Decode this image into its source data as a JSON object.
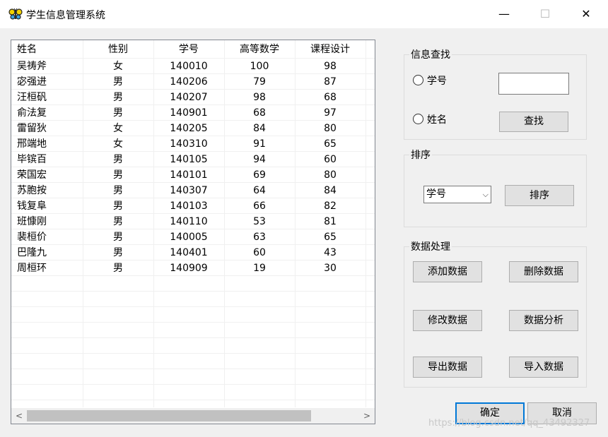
{
  "window": {
    "title": "学生信息管理系统",
    "minimize": "—",
    "maximize": "☐",
    "close": "✕"
  },
  "table": {
    "columns": [
      "姓名",
      "性别",
      "学号",
      "高等数学",
      "课程设计"
    ],
    "rows": [
      [
        "吴祷斧",
        "女",
        "140010",
        "100",
        "98"
      ],
      [
        "宓强进",
        "男",
        "140206",
        "79",
        "87"
      ],
      [
        "汪桓矾",
        "男",
        "140207",
        "98",
        "68"
      ],
      [
        "俞法复",
        "男",
        "140901",
        "68",
        "97"
      ],
      [
        "雷留狄",
        "女",
        "140205",
        "84",
        "80"
      ],
      [
        "邢端地",
        "女",
        "140310",
        "91",
        "65"
      ],
      [
        "毕镔百",
        "男",
        "140105",
        "94",
        "60"
      ],
      [
        "荣国宏",
        "男",
        "140101",
        "69",
        "80"
      ],
      [
        "苏胞按",
        "男",
        "140307",
        "64",
        "84"
      ],
      [
        "钱复阜",
        "男",
        "140103",
        "66",
        "82"
      ],
      [
        "班慷刚",
        "男",
        "140110",
        "53",
        "81"
      ],
      [
        "裴桓价",
        "男",
        "140005",
        "63",
        "65"
      ],
      [
        "巴隆九",
        "男",
        "140401",
        "60",
        "43"
      ],
      [
        "周桓环",
        "男",
        "140909",
        "19",
        "30"
      ]
    ],
    "scroll_left": "<",
    "scroll_right": ">"
  },
  "search_group": {
    "title": "信息查找",
    "radio_id_label": "学号",
    "radio_name_label": "姓名",
    "search_input_value": "",
    "search_button": "查找"
  },
  "sort_group": {
    "title": "排序",
    "sort_field_selected": "学号",
    "sort_button": "排序"
  },
  "data_group": {
    "title": "数据处理",
    "add_button": "添加数据",
    "delete_button": "删除数据",
    "modify_button": "修改数据",
    "analyze_button": "数据分析",
    "export_button": "导出数据",
    "import_button": "导入数据"
  },
  "footer": {
    "ok_button": "确定",
    "cancel_button": "取消"
  },
  "watermark": "https://blog.csdn.net/qq_43492327"
}
